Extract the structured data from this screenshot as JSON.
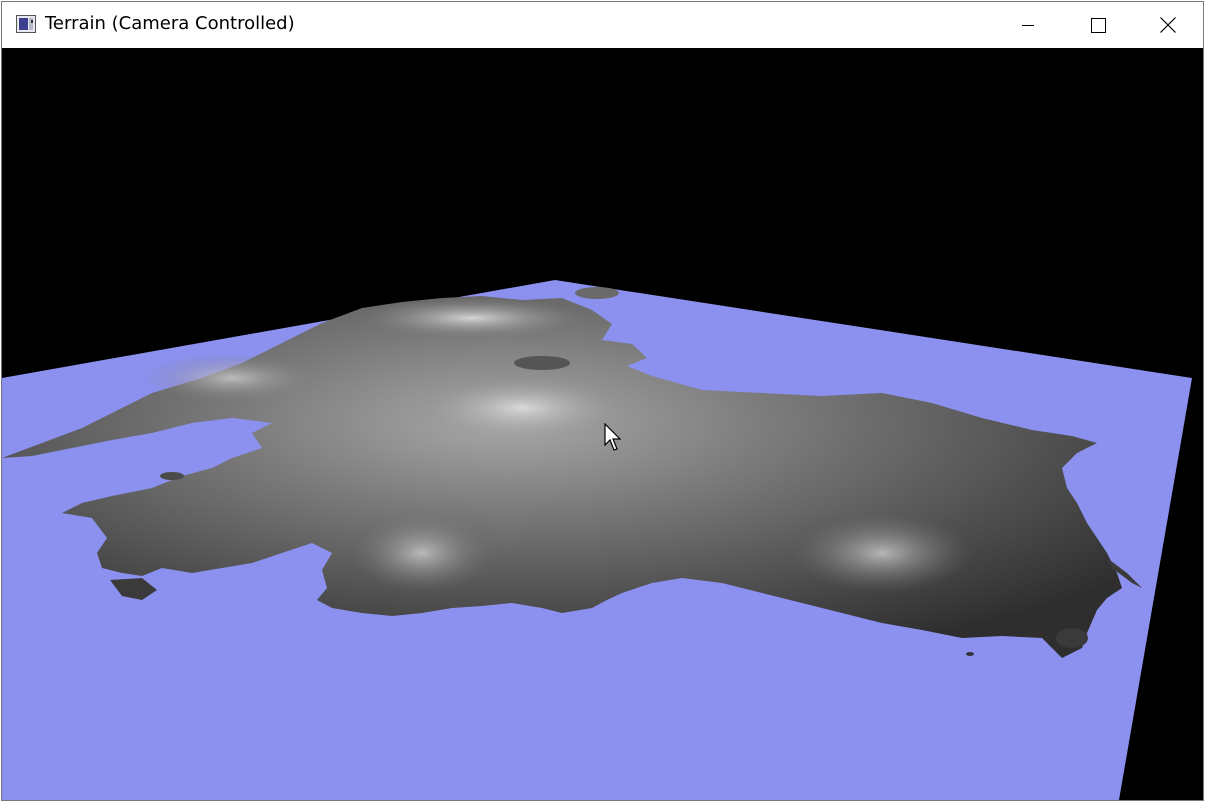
{
  "window": {
    "title": "Terrain (Camera Controlled)",
    "icon": "app-window-icon",
    "controls": {
      "minimize": "minimize-icon",
      "maximize": "maximize-icon",
      "close": "close-icon"
    }
  },
  "scene": {
    "background_color": "#000000",
    "water_color": "#8c91f0",
    "terrain_colors": [
      "#2a2a2a",
      "#5a5a5a",
      "#9a9a9a",
      "#d8d8d8"
    ]
  }
}
